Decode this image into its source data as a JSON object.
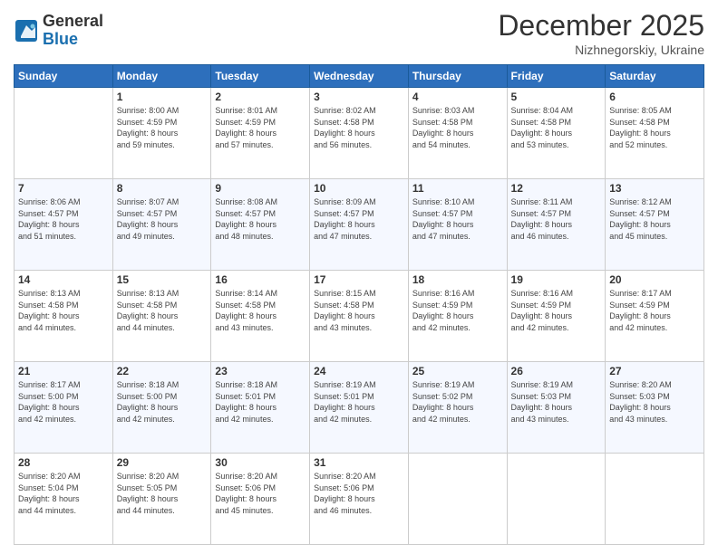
{
  "logo": {
    "general": "General",
    "blue": "Blue"
  },
  "header": {
    "month": "December 2025",
    "location": "Nizhnegorskiy, Ukraine"
  },
  "days_of_week": [
    "Sunday",
    "Monday",
    "Tuesday",
    "Wednesday",
    "Thursday",
    "Friday",
    "Saturday"
  ],
  "weeks": [
    [
      {
        "day": "",
        "info": ""
      },
      {
        "day": "1",
        "info": "Sunrise: 8:00 AM\nSunset: 4:59 PM\nDaylight: 8 hours\nand 59 minutes."
      },
      {
        "day": "2",
        "info": "Sunrise: 8:01 AM\nSunset: 4:59 PM\nDaylight: 8 hours\nand 57 minutes."
      },
      {
        "day": "3",
        "info": "Sunrise: 8:02 AM\nSunset: 4:58 PM\nDaylight: 8 hours\nand 56 minutes."
      },
      {
        "day": "4",
        "info": "Sunrise: 8:03 AM\nSunset: 4:58 PM\nDaylight: 8 hours\nand 54 minutes."
      },
      {
        "day": "5",
        "info": "Sunrise: 8:04 AM\nSunset: 4:58 PM\nDaylight: 8 hours\nand 53 minutes."
      },
      {
        "day": "6",
        "info": "Sunrise: 8:05 AM\nSunset: 4:58 PM\nDaylight: 8 hours\nand 52 minutes."
      }
    ],
    [
      {
        "day": "7",
        "info": "Sunrise: 8:06 AM\nSunset: 4:57 PM\nDaylight: 8 hours\nand 51 minutes."
      },
      {
        "day": "8",
        "info": "Sunrise: 8:07 AM\nSunset: 4:57 PM\nDaylight: 8 hours\nand 49 minutes."
      },
      {
        "day": "9",
        "info": "Sunrise: 8:08 AM\nSunset: 4:57 PM\nDaylight: 8 hours\nand 48 minutes."
      },
      {
        "day": "10",
        "info": "Sunrise: 8:09 AM\nSunset: 4:57 PM\nDaylight: 8 hours\nand 47 minutes."
      },
      {
        "day": "11",
        "info": "Sunrise: 8:10 AM\nSunset: 4:57 PM\nDaylight: 8 hours\nand 47 minutes."
      },
      {
        "day": "12",
        "info": "Sunrise: 8:11 AM\nSunset: 4:57 PM\nDaylight: 8 hours\nand 46 minutes."
      },
      {
        "day": "13",
        "info": "Sunrise: 8:12 AM\nSunset: 4:57 PM\nDaylight: 8 hours\nand 45 minutes."
      }
    ],
    [
      {
        "day": "14",
        "info": "Sunrise: 8:13 AM\nSunset: 4:58 PM\nDaylight: 8 hours\nand 44 minutes."
      },
      {
        "day": "15",
        "info": "Sunrise: 8:13 AM\nSunset: 4:58 PM\nDaylight: 8 hours\nand 44 minutes."
      },
      {
        "day": "16",
        "info": "Sunrise: 8:14 AM\nSunset: 4:58 PM\nDaylight: 8 hours\nand 43 minutes."
      },
      {
        "day": "17",
        "info": "Sunrise: 8:15 AM\nSunset: 4:58 PM\nDaylight: 8 hours\nand 43 minutes."
      },
      {
        "day": "18",
        "info": "Sunrise: 8:16 AM\nSunset: 4:59 PM\nDaylight: 8 hours\nand 42 minutes."
      },
      {
        "day": "19",
        "info": "Sunrise: 8:16 AM\nSunset: 4:59 PM\nDaylight: 8 hours\nand 42 minutes."
      },
      {
        "day": "20",
        "info": "Sunrise: 8:17 AM\nSunset: 4:59 PM\nDaylight: 8 hours\nand 42 minutes."
      }
    ],
    [
      {
        "day": "21",
        "info": "Sunrise: 8:17 AM\nSunset: 5:00 PM\nDaylight: 8 hours\nand 42 minutes."
      },
      {
        "day": "22",
        "info": "Sunrise: 8:18 AM\nSunset: 5:00 PM\nDaylight: 8 hours\nand 42 minutes."
      },
      {
        "day": "23",
        "info": "Sunrise: 8:18 AM\nSunset: 5:01 PM\nDaylight: 8 hours\nand 42 minutes."
      },
      {
        "day": "24",
        "info": "Sunrise: 8:19 AM\nSunset: 5:01 PM\nDaylight: 8 hours\nand 42 minutes."
      },
      {
        "day": "25",
        "info": "Sunrise: 8:19 AM\nSunset: 5:02 PM\nDaylight: 8 hours\nand 42 minutes."
      },
      {
        "day": "26",
        "info": "Sunrise: 8:19 AM\nSunset: 5:03 PM\nDaylight: 8 hours\nand 43 minutes."
      },
      {
        "day": "27",
        "info": "Sunrise: 8:20 AM\nSunset: 5:03 PM\nDaylight: 8 hours\nand 43 minutes."
      }
    ],
    [
      {
        "day": "28",
        "info": "Sunrise: 8:20 AM\nSunset: 5:04 PM\nDaylight: 8 hours\nand 44 minutes."
      },
      {
        "day": "29",
        "info": "Sunrise: 8:20 AM\nSunset: 5:05 PM\nDaylight: 8 hours\nand 44 minutes."
      },
      {
        "day": "30",
        "info": "Sunrise: 8:20 AM\nSunset: 5:06 PM\nDaylight: 8 hours\nand 45 minutes."
      },
      {
        "day": "31",
        "info": "Sunrise: 8:20 AM\nSunset: 5:06 PM\nDaylight: 8 hours\nand 46 minutes."
      },
      {
        "day": "",
        "info": ""
      },
      {
        "day": "",
        "info": ""
      },
      {
        "day": "",
        "info": ""
      }
    ]
  ]
}
